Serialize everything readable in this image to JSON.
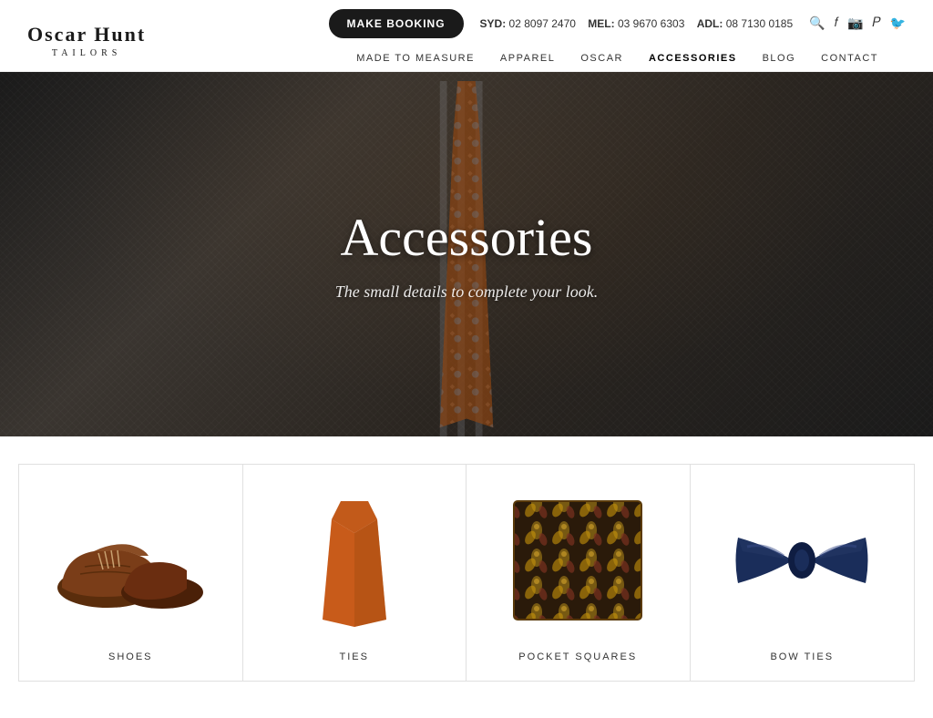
{
  "brand": {
    "name": "Oscar Hunt",
    "tagline": "TAILORS"
  },
  "header": {
    "booking_button": "MAKE BOOKING",
    "syd_label": "SYD:",
    "syd_phone": "02 8097 2470",
    "mel_label": "MEL:",
    "mel_phone": "03 9670 6303",
    "adl_label": "ADL:",
    "adl_phone": "08 7130 0185"
  },
  "nav": {
    "items": [
      {
        "label": "MADE TO MEASURE",
        "active": false
      },
      {
        "label": "APPAREL",
        "active": false
      },
      {
        "label": "OSCAR",
        "active": false
      },
      {
        "label": "ACCESSORIES",
        "active": true
      },
      {
        "label": "BLOG",
        "active": false
      },
      {
        "label": "CONTACT",
        "active": false
      }
    ]
  },
  "hero": {
    "title": "Accessories",
    "subtitle": "The small details to complete your look."
  },
  "products": [
    {
      "label": "SHOES",
      "type": "shoes"
    },
    {
      "label": "TIES",
      "type": "ties"
    },
    {
      "label": "POCKET SQUARES",
      "type": "pocket"
    },
    {
      "label": "BOW TIES",
      "type": "bowtie"
    }
  ]
}
